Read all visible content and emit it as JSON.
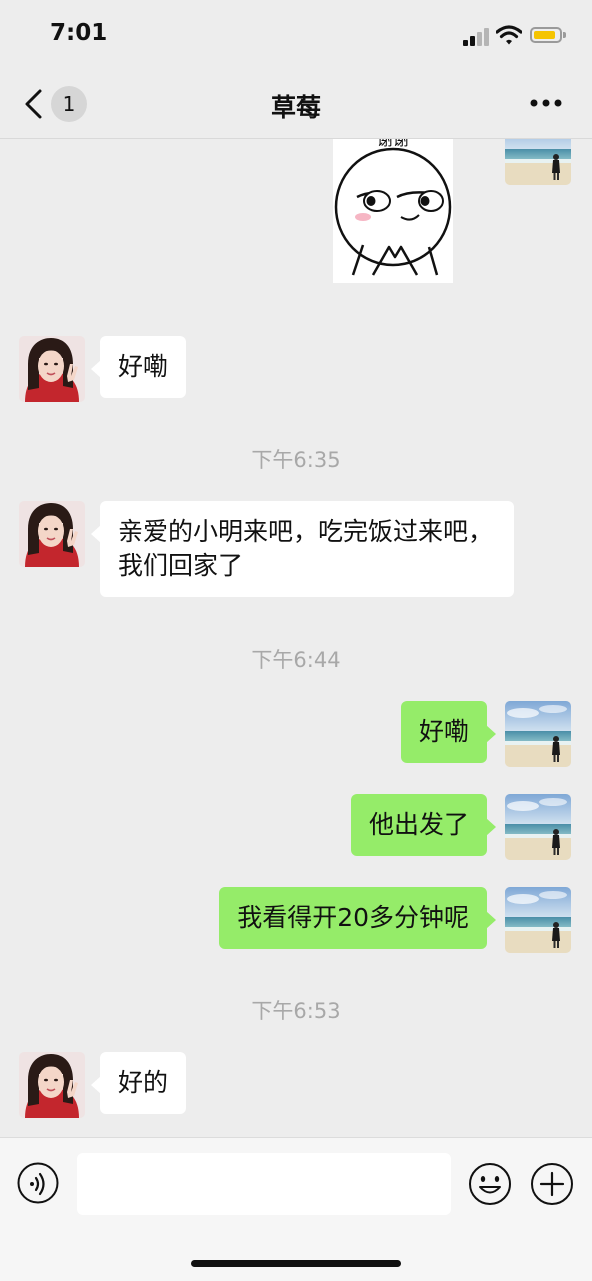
{
  "status_bar": {
    "time": "7:01",
    "battery_level": 0.75
  },
  "nav": {
    "title": "草莓",
    "unread_count": "1"
  },
  "sticker": {
    "caption": "谢谢"
  },
  "messages": [
    {
      "side": "in",
      "text": "好嘞"
    },
    {
      "timestamp": "下午6:35"
    },
    {
      "side": "in",
      "text": "亲爱的小明来吧，吃完饭过来吧，我们回家了"
    },
    {
      "timestamp": "下午6:44"
    },
    {
      "side": "out",
      "text": "好嘞"
    },
    {
      "side": "out",
      "text": "他出发了"
    },
    {
      "side": "out",
      "text": "我看得开20多分钟呢"
    },
    {
      "timestamp": "下午6:53"
    },
    {
      "side": "in",
      "text": "好的"
    }
  ],
  "input": {
    "value": "",
    "placeholder": ""
  },
  "icons": {
    "back": "chevron-left-icon",
    "more": "more-dots-icon",
    "voice": "voice-icon",
    "emoji": "emoji-icon",
    "plus": "plus-circle-icon"
  },
  "colors": {
    "background": "#ededed",
    "outgoing_bubble": "#95ec69",
    "incoming_bubble": "#ffffff",
    "timestamp_text": "#a8a8a8",
    "battery": "#f5c400"
  }
}
